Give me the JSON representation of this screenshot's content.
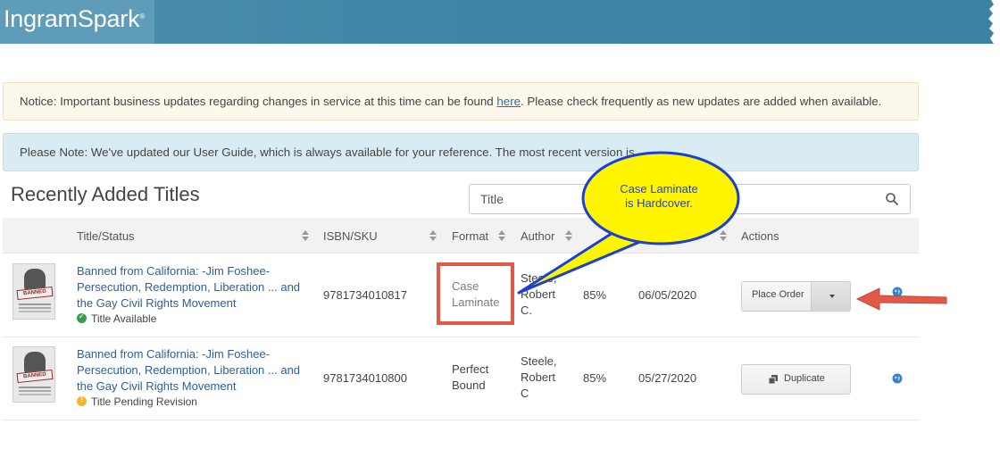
{
  "header": {
    "brand": "IngramSpark",
    "brand_mark": "®"
  },
  "notices": {
    "business": {
      "before_link": "Notice: Important business updates regarding changes in service at this time can be found ",
      "link": "here",
      "after_link": ". Please check frequently as new updates are added when available."
    },
    "guide": {
      "text": "Please Note: We've updated our User Guide, which is always available for your reference. The most recent version is"
    }
  },
  "titles_section": {
    "heading": "Recently Added Titles",
    "search_value": "Title"
  },
  "table": {
    "columns": {
      "title_status": "Title/Status",
      "isbn": "ISBN/SKU",
      "format": "Format",
      "author": "Author",
      "actions": "Actions"
    },
    "rows": [
      {
        "title": "Banned from California: -Jim Foshee- Persecution, Redemption, Liberation ... and the Gay Civil Rights Movement",
        "status": "Title Available",
        "isbn": "9781734010817",
        "format_line1": "Case",
        "format_line2": "Laminate",
        "author_line1": "Steele,",
        "author_line2": "Robert",
        "author_line3": "C.",
        "percent": "85%",
        "date": "06/05/2020",
        "action": "Place Order"
      },
      {
        "title": "Banned from California: -Jim Foshee- Persecution, Redemption, Liberation ... and the Gay Civil Rights Movement",
        "status": "Title Pending Revision",
        "isbn": "9781734010800",
        "format_line1": "Perfect",
        "format_line2": "Bound",
        "author_line1": "Steele,",
        "author_line2": "Robert",
        "author_line3": "C",
        "percent": "85%",
        "date": "05/27/2020",
        "action": "Duplicate"
      }
    ]
  },
  "annotation": {
    "line1": "Case Laminate",
    "line2": "is Hardcover.",
    "bubble_color": "#fff500",
    "bubble_border": "#1d3fd6",
    "arrow_color": "#e05a47"
  },
  "cover_stamp": "BANNED"
}
